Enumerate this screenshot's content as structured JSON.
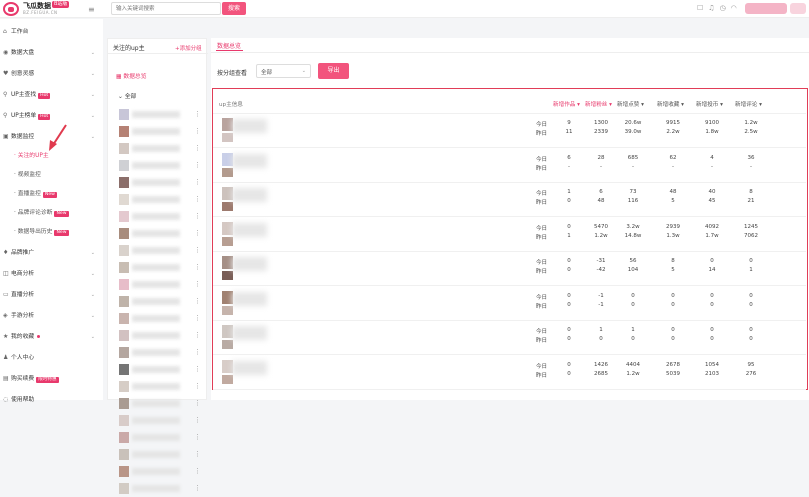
{
  "header": {
    "logo_title": "飞瓜数据",
    "logo_badge": "B站版",
    "logo_sub": "BZ.FEIGUA.CN",
    "search_placeholder": "输入关键词搜索",
    "search_button": "搜索"
  },
  "sidebar": {
    "items": [
      {
        "icon": "home-icon",
        "glyph": "⌂",
        "label": "工作台"
      },
      {
        "icon": "chart-icon",
        "glyph": "◉",
        "label": "数据大盘",
        "chevron": true
      },
      {
        "icon": "heart-icon",
        "glyph": "♥",
        "label": "创意灵感",
        "chevron": true
      },
      {
        "icon": "search-icon",
        "glyph": "⚲",
        "label": "UP主查找",
        "tag": "Hot",
        "chevron": true
      },
      {
        "icon": "search-icon",
        "glyph": "⚲",
        "label": "UP主榜单",
        "tag": "Hot",
        "chevron": true
      },
      {
        "icon": "monitor-icon",
        "glyph": "▣",
        "label": "数据监控",
        "chevron": true
      }
    ],
    "sub_items": [
      {
        "label": "关注的UP主",
        "active": true
      },
      {
        "label": "视频监控"
      },
      {
        "label": "直播监控",
        "tag": "New"
      },
      {
        "label": "品牌评论诊断",
        "tag": "New"
      },
      {
        "label": "数据导出历史",
        "tag": "New"
      }
    ],
    "items2": [
      {
        "icon": "shield-icon",
        "glyph": "♦",
        "label": "品牌推广",
        "chevron": true
      },
      {
        "icon": "cart-icon",
        "glyph": "◫",
        "label": "电商分析",
        "chevron": true
      },
      {
        "icon": "live-icon",
        "glyph": "▭",
        "label": "直播分析",
        "chevron": true
      },
      {
        "icon": "game-icon",
        "glyph": "◈",
        "label": "手游分析",
        "chevron": true
      },
      {
        "icon": "star-icon",
        "glyph": "★",
        "label": "我的收藏",
        "dot": true,
        "chevron": true
      },
      {
        "icon": "user-icon",
        "glyph": "♟",
        "label": "个人中心"
      },
      {
        "icon": "cart-icon",
        "glyph": "▤",
        "label": "购买续费",
        "tag": "限时特惠"
      },
      {
        "icon": "help-icon",
        "glyph": "◌",
        "label": "使用帮助"
      }
    ]
  },
  "follow_panel": {
    "title": "关注的up主",
    "add_group": "+添加分组",
    "overview": "数据总览",
    "all_label": "全部",
    "avatar_colors": [
      "#c8c6d8",
      "#b58174",
      "#d3c8c2",
      "#cfd0d4",
      "#8b6e6a",
      "#e0d9d2",
      "#e4c9cf",
      "#a88c7d",
      "#d9d2cc",
      "#c8bdb3",
      "#e7bdc9",
      "#bfb3a9",
      "#c9b4ae",
      "#d2c1c1",
      "#b4a69f",
      "#757575",
      "#d6cdc6",
      "#a99b92",
      "#d8ccc9",
      "#caa9a8",
      "#c9c1ba",
      "#b99587",
      "#d2cbc4"
    ]
  },
  "main": {
    "tab": "数据总览",
    "sort_label": "按分组查看",
    "sort_value": "全部",
    "export_button": "导出",
    "table": {
      "info_header": "up主信息",
      "columns": [
        {
          "label": "新增作品",
          "highlight": true
        },
        {
          "label": "新增粉丝",
          "highlight": true
        },
        {
          "label": "新增点赞",
          "highlight": false
        },
        {
          "label": "新增收藏",
          "highlight": false
        },
        {
          "label": "新增投币",
          "highlight": false
        },
        {
          "label": "新增评论",
          "highlight": false
        }
      ],
      "today_label": "今日",
      "yesterday_label": "昨日",
      "rows": [
        {
          "today": [
            "9",
            "1300",
            "20.6w",
            "9915",
            "9100",
            "1.2w"
          ],
          "yesterday": [
            "11",
            "2339",
            "39.0w",
            "2.2w",
            "1.8w",
            "2.5w"
          ],
          "colors": [
            "#b9a39e",
            "#d3c5c2"
          ]
        },
        {
          "today": [
            "6",
            "28",
            "685",
            "62",
            "4",
            "36"
          ],
          "yesterday": [
            "-",
            "-",
            "-",
            "-",
            "-",
            "-"
          ],
          "colors": [
            "#c9cfe8",
            "#b39b8e"
          ]
        },
        {
          "today": [
            "1",
            "6",
            "73",
            "48",
            "40",
            "8"
          ],
          "yesterday": [
            "0",
            "48",
            "116",
            "5",
            "45",
            "21"
          ],
          "colors": [
            "#cdc2bd",
            "#9d7a6e"
          ]
        },
        {
          "today": [
            "0",
            "5470",
            "3.2w",
            "2939",
            "4092",
            "1245"
          ],
          "yesterday": [
            "1",
            "1.2w",
            "14.8w",
            "1.3w",
            "1.7w",
            "7062"
          ],
          "colors": [
            "#d5c8c3",
            "#b79e92"
          ]
        },
        {
          "today": [
            "0",
            "-31",
            "56",
            "8",
            "0",
            "0"
          ],
          "yesterday": [
            "0",
            "-42",
            "104",
            "5",
            "14",
            "1"
          ],
          "colors": [
            "#a58f86",
            "#7a5e57"
          ]
        },
        {
          "today": [
            "0",
            "-1",
            "0",
            "0",
            "0",
            "0"
          ],
          "yesterday": [
            "0",
            "-1",
            "0",
            "0",
            "0",
            "0"
          ],
          "colors": [
            "#a18272",
            "#c6b4ac"
          ]
        },
        {
          "today": [
            "0",
            "1",
            "1",
            "0",
            "0",
            "0"
          ],
          "yesterday": [
            "0",
            "0",
            "0",
            "0",
            "0",
            "0"
          ],
          "colors": [
            "#cfc7c2",
            "#b9aba4"
          ]
        },
        {
          "today": [
            "0",
            "1426",
            "4404",
            "2678",
            "1054",
            "95"
          ],
          "yesterday": [
            "0",
            "2685",
            "1.2w",
            "5039",
            "2103",
            "276"
          ],
          "colors": [
            "#d8cdc8",
            "#c1aaa0"
          ]
        }
      ]
    }
  }
}
